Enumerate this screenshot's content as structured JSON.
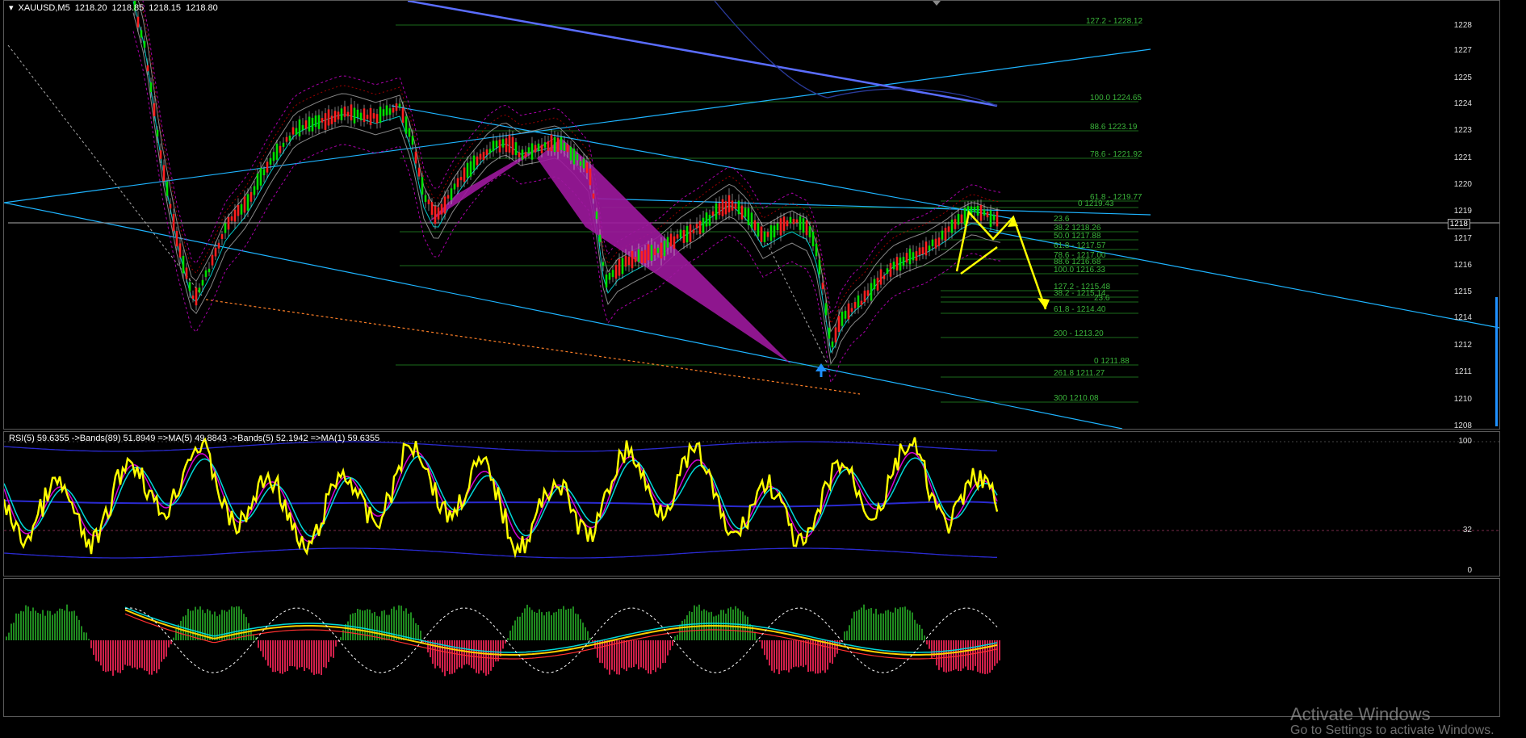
{
  "chart_header": {
    "symbol": "XAUUSD,M5",
    "open": "1218.20",
    "high": "1218.85",
    "low": "1218.15",
    "close": "1218.80"
  },
  "main_axis": {
    "ticks": [
      "1228",
      "1227",
      "1225",
      "1224",
      "1223",
      "1221",
      "1220",
      "1219",
      "1217",
      "1216",
      "1215",
      "1214",
      "1212",
      "1211",
      "1210",
      "1208"
    ],
    "current_price": "1218"
  },
  "fib_levels": [
    "127.2 - 1228.12",
    "100.0 1224.65",
    "88.6 1223.19",
    "78.6 - 1221.92",
    "61.8 - 1219.77",
    "0 1219.43",
    "23.6",
    "38.2 1218.26",
    "50.0 1217.88",
    "61.8 - 1217.57",
    "78.6 - 1217.00",
    "88.6 1216.68",
    "100.0 1216.33",
    "127.2 - 1215.48",
    "38.2 - 1215.14",
    "23.6",
    "61.8 - 1214.40",
    "200 - 1213.20",
    "0 1211.88",
    "261.8 1211.27",
    "300 1210.08"
  ],
  "rsi_panel": {
    "label": "RSI(5) 59.6355  ->Bands(89) 51.8949  =>MA(5) 49.8843  ->Bands(5) 52.1942  =>MA(1) 59.6355",
    "ticks": [
      "100",
      "32",
      "0"
    ]
  },
  "watermark": {
    "title": "Activate Windows",
    "subtitle": "Go to Settings to activate Windows."
  },
  "colors": {
    "bull_candle": "#00e000",
    "bear_candle": "#ff2020",
    "harmonic": "#a020a0",
    "projection": "#ffff00",
    "trendline": "#1eb4ff",
    "fib": "#2e8b2e",
    "rsi": "#ffff00"
  }
}
